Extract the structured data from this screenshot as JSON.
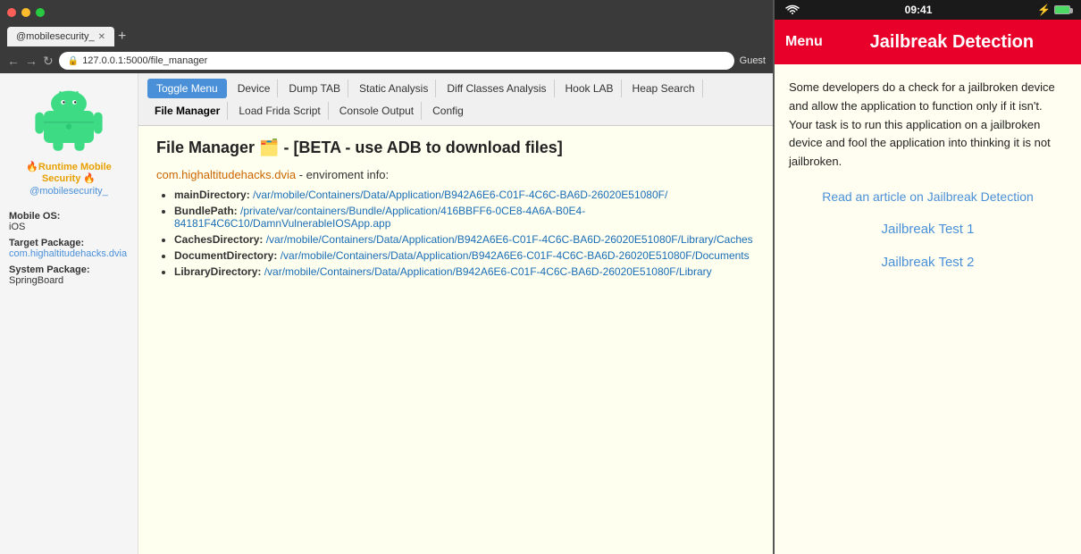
{
  "browser": {
    "tab_title": "@mobilesecurity_",
    "address": "127.0.0.1:5000/file_manager",
    "guest_label": "Guest"
  },
  "toolbar": {
    "toggle_menu": "Toggle Menu",
    "tabs": [
      "Device",
      "Dump TAB",
      "Static Analysis",
      "Diff Classes Analysis",
      "Hook LAB",
      "Heap Search",
      "File Manager",
      "Load Frida Script",
      "Console Output",
      "Config"
    ]
  },
  "page": {
    "title": "File Manager 🗂️ - [BETA - use ADB to download files]",
    "env_package": "com.highaltitudehacks.dvia",
    "env_label": "- enviroment info:",
    "env_items": [
      {
        "key": "mainDirectory:",
        "val": "/var/mobile/Containers/Data/Application/B942A6E6-C01F-4C6C-BA6D-26020E51080F/"
      },
      {
        "key": "BundlePath:",
        "val": "/private/var/containers/Bundle/Application/416BBFF6-0CE8-4A6A-B0E4-84181F4C6C10/DamnVulnerableIOSApp.app"
      },
      {
        "key": "CachesDirectory:",
        "val": "/var/mobile/Containers/Data/Application/B942A6E6-C01F-4C6C-BA6D-26020E51080F/Library/Caches"
      },
      {
        "key": "DocumentDirectory:",
        "val": "/var/mobile/Containers/Data/Application/B942A6E6-C01F-4C6C-BA6D-26020E51080F/Documents"
      },
      {
        "key": "LibraryDirectory:",
        "val": "/var/mobile/Containers/Data/Application/B942A6E6-C01F-4C6C-BA6D-26020E51080F/Library"
      }
    ]
  },
  "sidebar": {
    "runtime_label": "🔥Runtime Mobile Security 🔥",
    "handle": "@mobilesecurity_",
    "mobile_os_label": "Mobile OS:",
    "mobile_os_value": "iOS",
    "target_package_label": "Target Package:",
    "target_package_value": "com.highaltitudehacks.dvia",
    "system_package_label": "System Package:",
    "system_package_value": "SpringBoard"
  },
  "mobile": {
    "status_bar": {
      "time": "09:41",
      "battery_label": "⚡"
    },
    "header": {
      "menu_label": "Menu",
      "title": "Jailbreak Detection"
    },
    "description": "Some developers do a check for a jailbroken device and allow the application to function only if it isn't. Your task is to run this application on a jailbroken device and fool the application into thinking it is not jailbroken.",
    "article_link": "Read an article on Jailbreak Detection",
    "test1_label": "Jailbreak Test 1",
    "test2_label": "Jailbreak Test 2"
  }
}
